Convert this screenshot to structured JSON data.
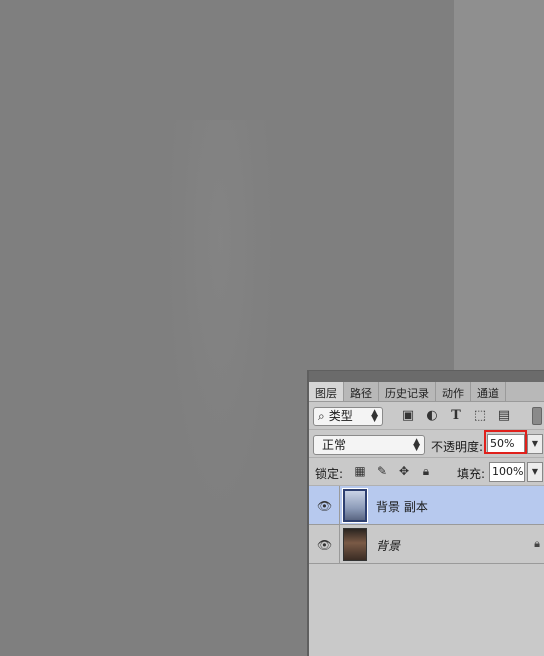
{
  "panel": {
    "tabs": [
      {
        "label": "图层"
      },
      {
        "label": "路径"
      },
      {
        "label": "历史记录"
      },
      {
        "label": "动作"
      },
      {
        "label": "通道"
      }
    ],
    "filter": {
      "label": "类型",
      "icon": "search-icon"
    },
    "blend_mode": "正常",
    "opacity_label": "不透明度:",
    "opacity_value": "50%",
    "lock_label": "锁定:",
    "fill_label": "填充:",
    "fill_value": "100%",
    "layers": [
      {
        "name": "背景 副本",
        "visible": true,
        "selected": true
      },
      {
        "name": "背景",
        "visible": true,
        "selected": false,
        "locked": true
      }
    ],
    "colors": {
      "selection": "#b7c9ee",
      "highlight": "#e0201b"
    }
  }
}
